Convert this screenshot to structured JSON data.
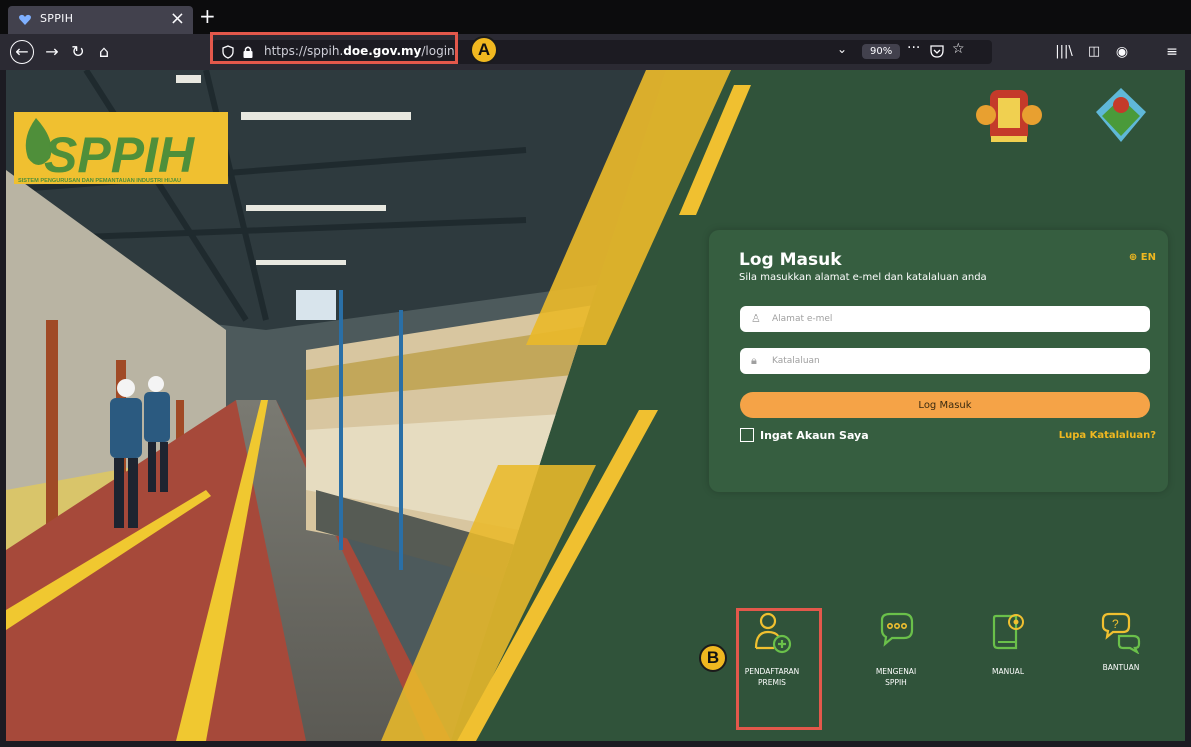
{
  "browser": {
    "tab_title": "SPPIH",
    "url_prefix": "https://sppih.",
    "url_domain": "doe.gov.my",
    "url_path": "/login",
    "zoom": "90%"
  },
  "annotations": {
    "a": "A",
    "b": "B"
  },
  "hero": {
    "logo_text": "SPPIH",
    "logo_subtitle": "SISTEM PENGURUSAN DAN PEMANTAUAN INDUSTRI HIJAU"
  },
  "login": {
    "title": "Log Masuk",
    "subtitle": "Sila masukkan alamat e-mel dan katalaluan anda",
    "lang": "EN",
    "email_placeholder": "Alamat e-mel",
    "password_placeholder": "Katalaluan",
    "submit": "Log Masuk",
    "remember": "Ingat Akaun Saya",
    "forgot": "Lupa Katalaluan?"
  },
  "menu": {
    "register_l1": "PENDAFTARAN",
    "register_l2": "PREMIS",
    "about_l1": "MENGENAI",
    "about_l2": "SPPIH",
    "manual": "MANUAL",
    "help": "BANTUAN"
  },
  "colors": {
    "green_bg": "#30533a",
    "accent_yellow": "#f0b820",
    "button_orange": "#f5a347",
    "annotation_red": "#e3584b"
  }
}
